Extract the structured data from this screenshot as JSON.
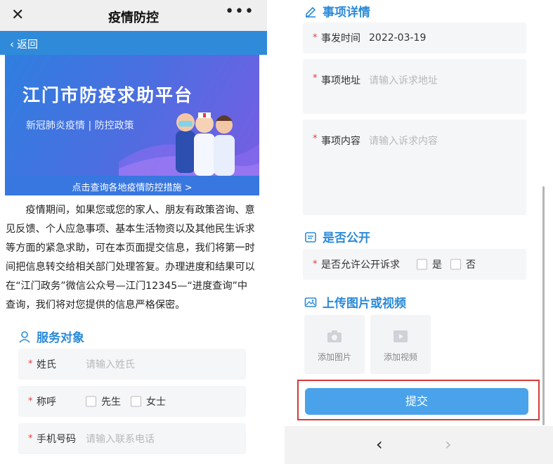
{
  "left": {
    "topbar": {
      "title": "疫情防控",
      "close_icon": "close-icon",
      "more_icon": "more-icon"
    },
    "back": {
      "label": "返回"
    },
    "banner": {
      "title": "江门市防疫求助平台",
      "subtitle": "新冠肺炎疫情 | 防控政策",
      "link": "点击查询各地疫情防控措施 >"
    },
    "intro": "疫情期间，如果您或您的家人、朋友有政策咨询、意见反馈、个人应急事项、基本生活物资以及其他民生诉求等方面的紧急求助，可在本页面提交信息，我们将第一时间把信息转交给相关部门处理答复。办理进度和结果可以在“江门政务”微信公众号—江门12345—“进度查询”中查询，我们将对您提供的信息严格保密。",
    "service_section": {
      "title": "服务对象",
      "surname": {
        "label": "姓氏",
        "placeholder": "请输入姓氏"
      },
      "salutation": {
        "label": "称呼",
        "options": [
          "先生",
          "女士"
        ]
      },
      "phone": {
        "label": "手机号码",
        "placeholder": "请输入联系电话"
      }
    }
  },
  "right": {
    "details_section": {
      "title": "事项详情",
      "date": {
        "label": "事发时间",
        "value": "2022-03-19"
      },
      "address": {
        "label": "事项地址",
        "placeholder": "请输入诉求地址"
      },
      "content": {
        "label": "事项内容",
        "placeholder": "请输入诉求内容"
      }
    },
    "public_section": {
      "title": "是否公开",
      "allow": {
        "label": "是否允许公开诉求",
        "options": [
          "是",
          "否"
        ]
      }
    },
    "upload_section": {
      "title": "上传图片或视频",
      "add_image": "添加图片",
      "add_video": "添加视频"
    },
    "submit_label": "提交"
  },
  "colors": {
    "accent": "#2b8ad8",
    "required": "#e23b3b",
    "submit": "#4aa3ea",
    "highlight_border": "#d73a3a"
  }
}
